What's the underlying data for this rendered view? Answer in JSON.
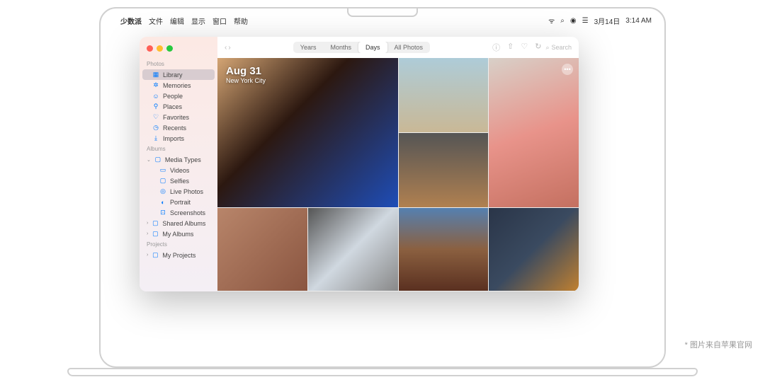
{
  "menubar": {
    "app": "少数派",
    "items": [
      "文件",
      "编辑",
      "显示",
      "窗口",
      "帮助"
    ],
    "date": "3月14日",
    "time": "3:14 AM"
  },
  "sidebar": {
    "sections": [
      {
        "header": "Photos",
        "items": [
          {
            "label": "Library",
            "icon": "▦",
            "selected": true
          },
          {
            "label": "Memories",
            "icon": "✲"
          },
          {
            "label": "People",
            "icon": "☺"
          },
          {
            "label": "Places",
            "icon": "⚲"
          },
          {
            "label": "Favorites",
            "icon": "♡"
          },
          {
            "label": "Recents",
            "icon": "◷"
          },
          {
            "label": "Imports",
            "icon": "⤓"
          }
        ]
      },
      {
        "header": "Albums",
        "items": [
          {
            "label": "Media Types",
            "icon": "▢",
            "exp": true,
            "children": [
              {
                "label": "Videos",
                "icon": "▭"
              },
              {
                "label": "Selfies",
                "icon": "▢"
              },
              {
                "label": "Live Photos",
                "icon": "◎"
              },
              {
                "label": "Portrait",
                "icon": "◐"
              },
              {
                "label": "Screenshots",
                "icon": "⊡"
              }
            ]
          },
          {
            "label": "Shared Albums",
            "icon": "▢",
            "chev": true
          },
          {
            "label": "My Albums",
            "icon": "▢",
            "chev": true
          }
        ]
      },
      {
        "header": "Projects",
        "items": [
          {
            "label": "My Projects",
            "icon": "▢",
            "chev": true
          }
        ]
      }
    ]
  },
  "toolbar": {
    "tabs": [
      "Years",
      "Months",
      "Days",
      "All Photos"
    ],
    "active": 2,
    "search": "Search"
  },
  "overlay": {
    "date": "Aug 31",
    "location": "New York City",
    "badge": "•••"
  },
  "caption": "* 图片来自苹果官网"
}
